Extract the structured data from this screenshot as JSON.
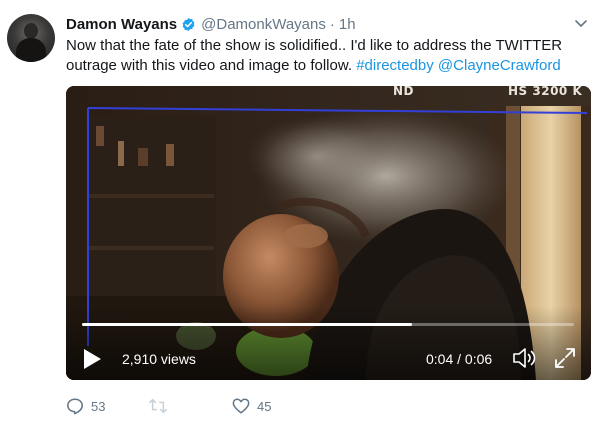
{
  "tweet": {
    "author_name": "Damon Wayans",
    "handle": "@DamonkWayans",
    "separator": "·",
    "time": "1h",
    "text_main": "Now that the fate of the show is solidified.. I'd like to address the TWITTER outrage with this video and image to follow.",
    "hashtag": "#directedby",
    "mention": "@ClayneCrawford"
  },
  "video": {
    "overlay_left": "ND",
    "overlay_right": "HS 3200 K",
    "views": "2,910 views",
    "timecode": "0:04 / 0:06",
    "progress": 0.67
  },
  "actions": {
    "reply_count": "53",
    "like_count": "45"
  },
  "icons": {
    "avatar": "profile-photo",
    "verified": "verified-badge-icon",
    "chevron": "chevron-down-icon",
    "play": "play-icon",
    "volume": "volume-icon",
    "fullscreen": "fullscreen-icon",
    "reply": "reply-icon",
    "retweet": "retweet-icon",
    "like": "heart-icon"
  },
  "colors": {
    "link": "#1b95e0",
    "meta": "#657786",
    "verified": "#1da1f2",
    "text": "#14171a"
  }
}
